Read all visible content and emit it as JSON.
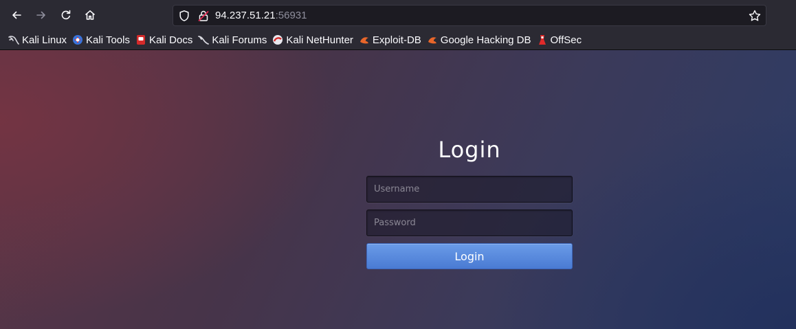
{
  "browser": {
    "url_host": "94.237.51.21",
    "url_port": ":56931",
    "icons": {
      "back": "back-arrow-icon",
      "forward": "forward-arrow-icon",
      "reload": "reload-icon",
      "home": "home-icon",
      "tracking": "shield-icon",
      "insecure": "insecure-lock-icon",
      "bookmark": "star-icon"
    }
  },
  "bookmarks": [
    {
      "label": "Kali Linux"
    },
    {
      "label": "Kali Tools"
    },
    {
      "label": "Kali Docs"
    },
    {
      "label": "Kali Forums"
    },
    {
      "label": "Kali NetHunter"
    },
    {
      "label": "Exploit-DB"
    },
    {
      "label": "Google Hacking DB"
    },
    {
      "label": "OffSec"
    }
  ],
  "login": {
    "title": "Login",
    "username_placeholder": "Username",
    "username_value": "",
    "password_placeholder": "Password",
    "password_value": "",
    "submit_label": "Login"
  },
  "colors": {
    "accent": "#5a8ae0",
    "toolbar": "#2b2a33"
  }
}
